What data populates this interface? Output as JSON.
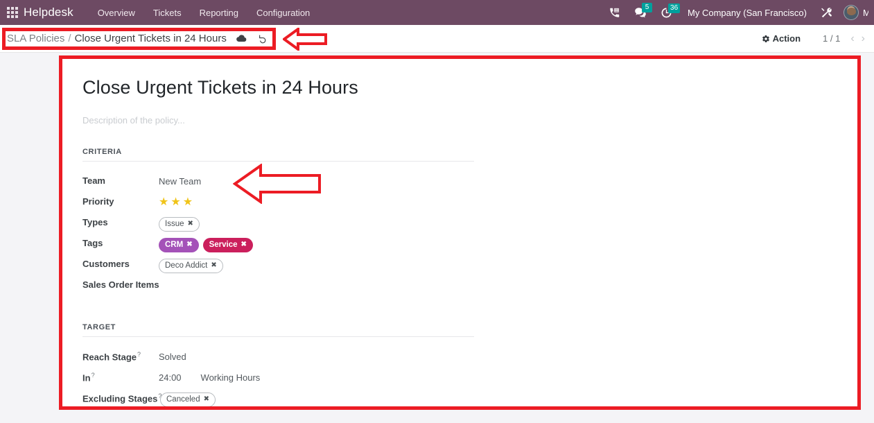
{
  "navbar": {
    "apps_icon": "apps-grid-icon",
    "app_name": "Helpdesk",
    "menu": [
      {
        "label": "Overview",
        "name": "nav-item-overview"
      },
      {
        "label": "Tickets",
        "name": "nav-item-tickets"
      },
      {
        "label": "Reporting",
        "name": "nav-item-reporting"
      },
      {
        "label": "Configuration",
        "name": "nav-item-configuration"
      }
    ],
    "systray": {
      "voip_icon": "phone-dialpad-icon",
      "messages_icon": "chat-bubble-icon",
      "messages_count": "5",
      "activities_icon": "clock-icon",
      "activities_count": "36",
      "company": "My Company (San Francisco)",
      "debug_icon": "tools-wrench-icon",
      "avatar_icon": "user-avatar",
      "user_name": "M"
    },
    "accent_badge_color": "#00a09d",
    "bar_color": "#6d4a63"
  },
  "control_panel": {
    "breadcrumb_parent": "SLA Policies",
    "breadcrumb_separator": "/",
    "breadcrumb_current": "Close Urgent Tickets in 24 Hours",
    "save_icon": "cloud-save-icon",
    "discard_icon": "undo-revert-icon",
    "action_label": "Action",
    "action_icon": "gear-icon",
    "pager": "1 / 1",
    "prev_icon": "chevron-left-icon",
    "next_icon": "chevron-right-icon"
  },
  "form": {
    "title": "Close Urgent Tickets in 24 Hours",
    "description_placeholder": "Description of the policy...",
    "criteria": {
      "section_label": "CRITERIA",
      "fields": [
        {
          "label": "Team",
          "name": "field-team",
          "type": "text",
          "value": "New Team"
        },
        {
          "label": "Priority",
          "name": "field-priority",
          "type": "stars",
          "stars_filled": 3,
          "star_color": "#f0c419"
        },
        {
          "label": "Types",
          "name": "field-types",
          "type": "tags",
          "tags": [
            {
              "label": "Issue",
              "style": "outline"
            }
          ]
        },
        {
          "label": "Tags",
          "name": "field-tags",
          "type": "tags",
          "tags": [
            {
              "label": "CRM",
              "style": "solid",
              "color": "#a452b8"
            },
            {
              "label": "Service",
              "style": "solid",
              "color": "#cb1f5c"
            }
          ]
        },
        {
          "label": "Customers",
          "name": "field-customers",
          "type": "tags",
          "tags": [
            {
              "label": "Deco Addict",
              "style": "outline"
            }
          ]
        },
        {
          "label": "Sales Order Items",
          "name": "field-sales-order-items",
          "type": "text",
          "value": ""
        }
      ]
    },
    "target": {
      "section_label": "TARGET",
      "fields": [
        {
          "label": "Reach Stage",
          "help": "?",
          "name": "field-reach-stage",
          "type": "text",
          "value": "Solved"
        },
        {
          "label": "In",
          "help": "?",
          "name": "field-in",
          "type": "duo",
          "value": "24:00",
          "value2": "Working Hours"
        },
        {
          "label": "Excluding Stages",
          "help": "?",
          "name": "field-excluding-stages",
          "type": "tags",
          "tags": [
            {
              "label": "Canceled",
              "style": "outline"
            }
          ]
        }
      ]
    }
  },
  "annotations": {
    "color": "#ec1c24",
    "boxes": [
      {
        "name": "annotation-box-breadcrumb"
      },
      {
        "name": "annotation-box-form-sheet"
      }
    ],
    "arrows": [
      {
        "name": "annotation-arrow-breadcrumb",
        "direction": "left"
      },
      {
        "name": "annotation-arrow-criteria",
        "direction": "left"
      }
    ]
  }
}
